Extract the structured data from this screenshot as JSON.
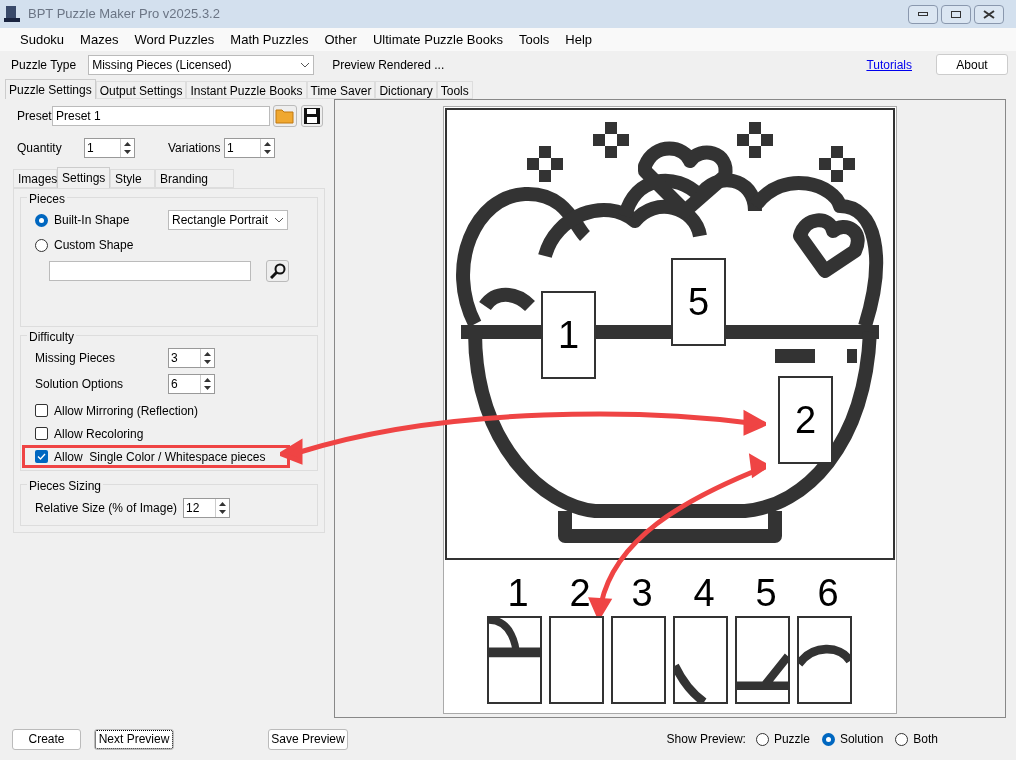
{
  "window": {
    "title": "BPT Puzzle Maker Pro v2025.3.2"
  },
  "menu": [
    "Sudoku",
    "Mazes",
    "Word Puzzles",
    "Math Puzzles",
    "Other",
    "Ultimate Puzzle Books",
    "Tools",
    "Help"
  ],
  "toolbar": {
    "puzzle_type_label": "Puzzle Type",
    "puzzle_type": "Missing Pieces (Licensed)",
    "status": "Preview Rendered ...",
    "tutorials_link": "Tutorials",
    "about_button": "About"
  },
  "main_tabs": [
    {
      "label": "Puzzle Settings",
      "selected": true
    },
    {
      "label": "Output Settings",
      "selected": false
    },
    {
      "label": "Instant Puzzle Books",
      "selected": false
    },
    {
      "label": "Time Saver",
      "selected": false
    },
    {
      "label": "Dictionary",
      "selected": false
    },
    {
      "label": "Tools",
      "selected": false
    }
  ],
  "preset": {
    "label": "Preset",
    "value": "Preset 1"
  },
  "quantity": {
    "label": "Quantity",
    "value": "1"
  },
  "variations": {
    "label": "Variations",
    "value": "1"
  },
  "sub_tabs": [
    {
      "label": "Images",
      "selected": false
    },
    {
      "label": "Settings",
      "selected": true
    },
    {
      "label": "Style",
      "selected": false
    },
    {
      "label": "Branding",
      "selected": false
    }
  ],
  "pieces": {
    "title": "Pieces",
    "options": [
      {
        "label": "Built-In Shape",
        "selected": true
      },
      {
        "label": "Custom Shape",
        "selected": false
      }
    ],
    "shape": "Rectangle Portrait"
  },
  "difficulty": {
    "title": "Difficulty",
    "spinners": [
      {
        "label": "Missing Pieces",
        "value": "3"
      },
      {
        "label": "Solution Options",
        "value": "6"
      }
    ],
    "checkboxes": [
      {
        "label": "Allow Mirroring (Reflection)",
        "checked": false,
        "highlighted": false
      },
      {
        "label": "Allow Recoloring",
        "checked": false,
        "highlighted": false
      },
      {
        "label": "Allow  Single Color / Whitespace pieces",
        "checked": true,
        "highlighted": true
      }
    ]
  },
  "sizing": {
    "title": "Pieces Sizing",
    "label": "Relative Size (% of Image)",
    "value": "12"
  },
  "preview": {
    "image_tags": [
      "1",
      "5",
      "2"
    ],
    "options": [
      "1",
      "2",
      "3",
      "4",
      "5",
      "6"
    ]
  },
  "bottom": {
    "buttons": [
      "Create",
      "Next Preview",
      "Save Preview"
    ],
    "show_label": "Show Preview:",
    "show_options": [
      {
        "label": "Puzzle",
        "selected": false
      },
      {
        "label": "Solution",
        "selected": true
      },
      {
        "label": "Both",
        "selected": false
      }
    ]
  }
}
